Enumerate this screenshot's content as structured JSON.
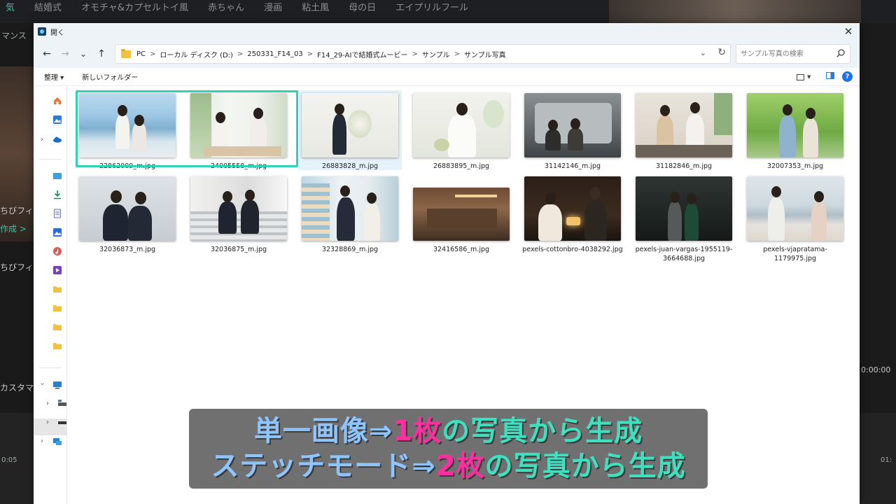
{
  "background_app": {
    "tabs": [
      "気",
      "結婚式",
      "オモチャ&カプセルトイ風",
      "赤ちゃん",
      "漫画",
      "粘土風",
      "母の日",
      "エイプリルフール"
    ],
    "left_texts": [
      "マンス",
      "ちびフィギ",
      "作成 >",
      "ちびフィギ",
      "カスタマイ",
      "0:05"
    ],
    "right_texts": [
      "0:00:00",
      "01:"
    ]
  },
  "dialog": {
    "title": "開く",
    "close_label": "✕"
  },
  "navigation": {
    "back": "←",
    "forward": "→",
    "recent": "⌄",
    "up": "↑",
    "breadcrumbs": [
      "PC",
      "ローカル ディスク (D:)",
      "250331_F14_03",
      "F14_29-AIで結婚式ムービー",
      "サンプル",
      "サンプル写真"
    ],
    "separator": ">",
    "search_placeholder": "サンプル写真の検索"
  },
  "commandbar": {
    "organize": "整理 ▾",
    "new_folder": "新しいフォルダー",
    "help": "?"
  },
  "icons": {
    "search": "search-icon",
    "folder": "folder-icon",
    "refresh": "refresh-icon"
  },
  "files": [
    {
      "name": "22862009_m.jpg",
      "selected": true
    },
    {
      "name": "24005558_m.jpg",
      "selected": true
    },
    {
      "name": "26883828_m.jpg",
      "hover": true
    },
    {
      "name": "26883895_m.jpg"
    },
    {
      "name": "31142146_m.jpg"
    },
    {
      "name": "31182846_m.jpg"
    },
    {
      "name": "32007353_m.jpg"
    },
    {
      "name": "32036873_m.jpg"
    },
    {
      "name": "32036875_m.jpg"
    },
    {
      "name": "32328869_m.jpg"
    },
    {
      "name": "32416586_m.jpg"
    },
    {
      "name": "pexels-cottonbro-4038292.jpg"
    },
    {
      "name": "pexels-juan-vargas-1955119-3664688.jpg"
    },
    {
      "name": "pexels-vjapratama-1179975.jpg"
    }
  ],
  "caption": {
    "line1": {
      "a": "単一画像⇒",
      "b": "1枚",
      "c": "の写真から生成"
    },
    "line2": {
      "a": "ステッチモード⇒",
      "b": "2枚",
      "c": "の写真から生成"
    }
  },
  "colors": {
    "selection": "#2fd3b4",
    "caption_blue": "#8fc5ff",
    "caption_pink": "#ff2fa0",
    "caption_teal": "#3fe0c0"
  }
}
